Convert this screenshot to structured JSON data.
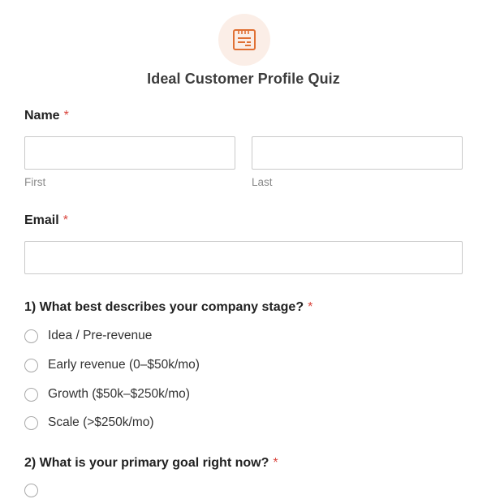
{
  "form": {
    "title": "Ideal Customer Profile Quiz",
    "logo_icon": "form-document-icon",
    "accent_color": "#e07034"
  },
  "name_field": {
    "label": "Name",
    "required_mark": "*",
    "first": {
      "value": "",
      "sublabel": "First"
    },
    "last": {
      "value": "",
      "sublabel": "Last"
    }
  },
  "email_field": {
    "label": "Email",
    "required_mark": "*",
    "value": ""
  },
  "questions": [
    {
      "label": "1) What best describes your company stage?",
      "required_mark": "*",
      "options": [
        "Idea / Pre-revenue",
        "Early revenue (0–$50k/mo)",
        "Growth ($50k–$250k/mo)",
        "Scale (>$250k/mo)"
      ]
    },
    {
      "label": "2) What is your primary goal right now?",
      "required_mark": "*"
    }
  ]
}
